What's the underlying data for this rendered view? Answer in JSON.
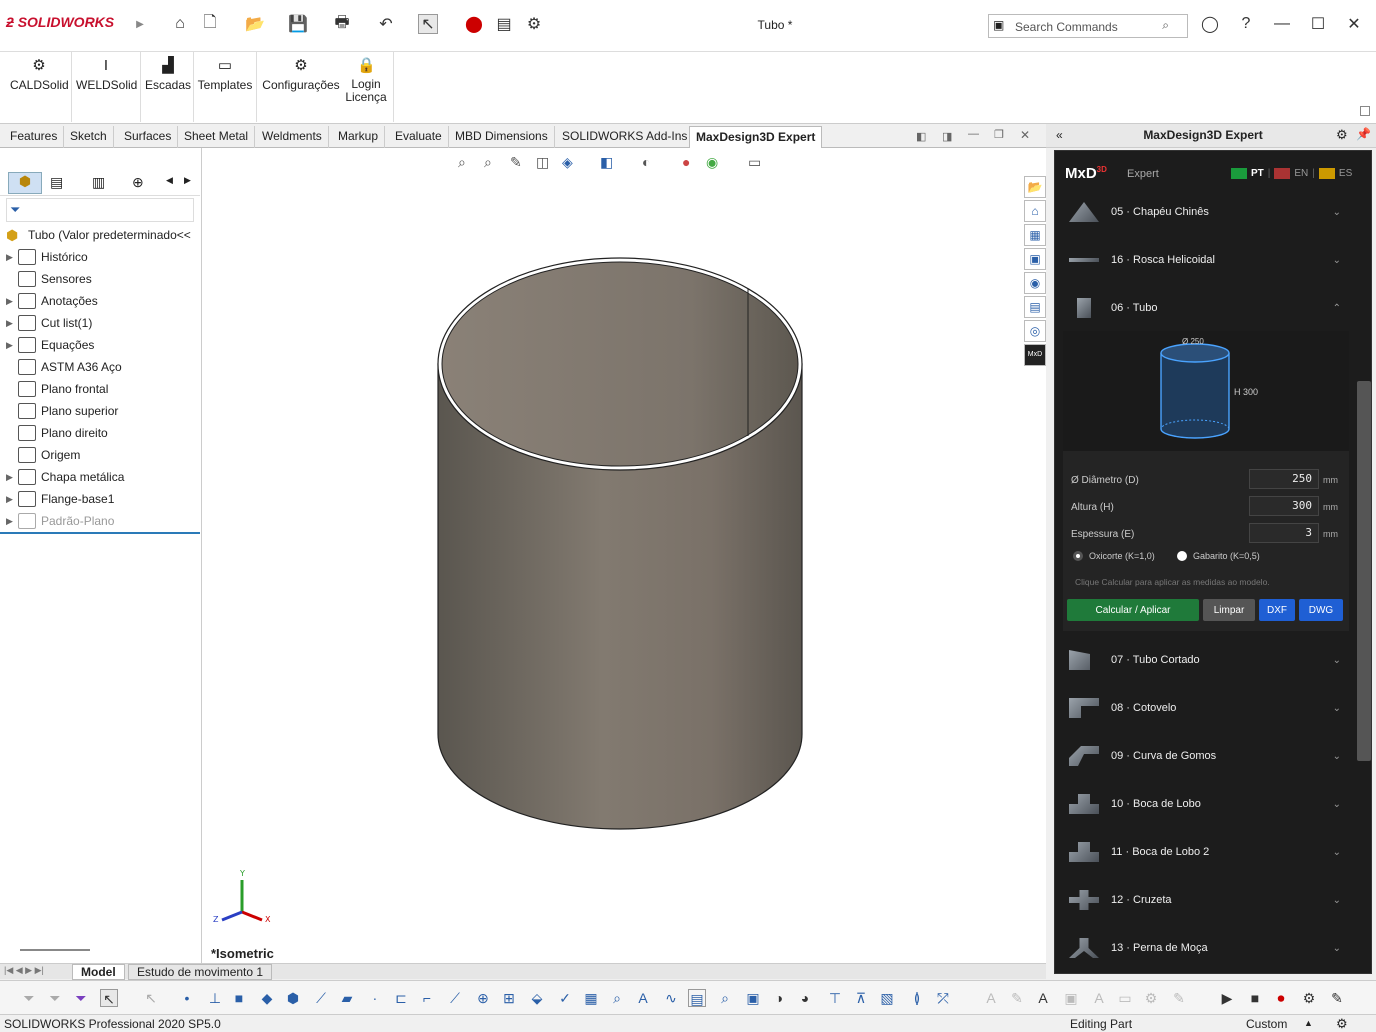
{
  "titlebar": {
    "brand": "SOLIDWORKS",
    "doc_title": "Tubo *",
    "search_placeholder": "Search Commands"
  },
  "ribbon": {
    "buttons": [
      {
        "label": "CALDSolid",
        "icon": "cald-icon"
      },
      {
        "label": "WELDSolid",
        "icon": "beam-icon"
      },
      {
        "label": "Escadas",
        "icon": "stairs-icon"
      },
      {
        "label": "Templates",
        "icon": "templates-icon"
      },
      {
        "label": "Configurações",
        "icon": "gear-icon"
      },
      {
        "label": "Login\nLicença",
        "icon": "lock-icon"
      }
    ]
  },
  "tabs": [
    "Features",
    "Sketch",
    "Surfaces",
    "Sheet Metal",
    "Weldments",
    "Markup",
    "Evaluate",
    "MBD Dimensions",
    "SOLIDWORKS Add-Ins",
    "MaxDesign3D Expert"
  ],
  "active_tab": "MaxDesign3D Expert",
  "tree": {
    "root": "Tubo  (Valor predeterminado<<",
    "items": [
      {
        "label": "Histórico",
        "expandable": true,
        "icon": "history-icon"
      },
      {
        "label": "Sensores",
        "expandable": false,
        "icon": "sensor-icon"
      },
      {
        "label": "Anotações",
        "expandable": true,
        "icon": "annotation-icon"
      },
      {
        "label": "Cut list(1)",
        "expandable": true,
        "icon": "cutlist-icon"
      },
      {
        "label": "Equações",
        "expandable": true,
        "icon": "equation-icon"
      },
      {
        "label": "ASTM A36 Aço",
        "expandable": false,
        "icon": "material-icon"
      },
      {
        "label": "Plano frontal",
        "expandable": false,
        "icon": "plane-icon"
      },
      {
        "label": "Plano superior",
        "expandable": false,
        "icon": "plane-icon"
      },
      {
        "label": "Plano direito",
        "expandable": false,
        "icon": "plane-icon"
      },
      {
        "label": "Origem",
        "expandable": false,
        "icon": "origin-icon"
      },
      {
        "label": "Chapa metálica",
        "expandable": true,
        "icon": "sheetmetal-icon"
      },
      {
        "label": "Flange-base1",
        "expandable": true,
        "icon": "flange-icon"
      },
      {
        "label": "Padrão-Plano",
        "expandable": true,
        "icon": "flat-pattern-icon",
        "disabled": true
      }
    ]
  },
  "viewport": {
    "view_label": "*Isometric"
  },
  "panel": {
    "title": "MaxDesign3D Expert",
    "brand": "MxD",
    "brand_sup": "3D",
    "subtitle": "Expert",
    "langs": [
      "PT",
      "EN",
      "ES"
    ],
    "items_top": [
      {
        "label": "05 · Chapéu Chinês"
      },
      {
        "label": "16 · Rosca Helicoidal"
      },
      {
        "label": "06 · Tubo"
      }
    ],
    "drawing": {
      "diameter": "Ø 250",
      "height": "H 300"
    },
    "fields": [
      {
        "label": "Ø Diâmetro (D)",
        "value": "250",
        "unit": "mm"
      },
      {
        "label": "Altura (H)",
        "value": "300",
        "unit": "mm"
      },
      {
        "label": "Espessura (E)",
        "value": "3",
        "unit": "mm"
      }
    ],
    "radios": [
      "Oxicorte (K=1,0)",
      "Gabarito (K=0,5)"
    ],
    "hint": "Clique Calcular para aplicar as medidas ao modelo.",
    "buttons": {
      "calc": "Calcular / Aplicar",
      "clear": "Limpar",
      "dxf": "DXF",
      "dwg": "DWG"
    },
    "items_bottom": [
      {
        "label": "07 · Tubo Cortado"
      },
      {
        "label": "08 · Cotovelo"
      },
      {
        "label": "09 · Curva de Gomos"
      },
      {
        "label": "10 · Boca de Lobo"
      },
      {
        "label": "11 · Boca de Lobo 2"
      },
      {
        "label": "12 · Cruzeta"
      },
      {
        "label": "13 · Perna de Moça"
      }
    ]
  },
  "bottom_tabs": [
    "Model",
    "Estudo de movimento 1"
  ],
  "status": {
    "product": "SOLIDWORKS Professional 2020 SP5.0",
    "mode": "Editing Part",
    "units": "Custom"
  }
}
